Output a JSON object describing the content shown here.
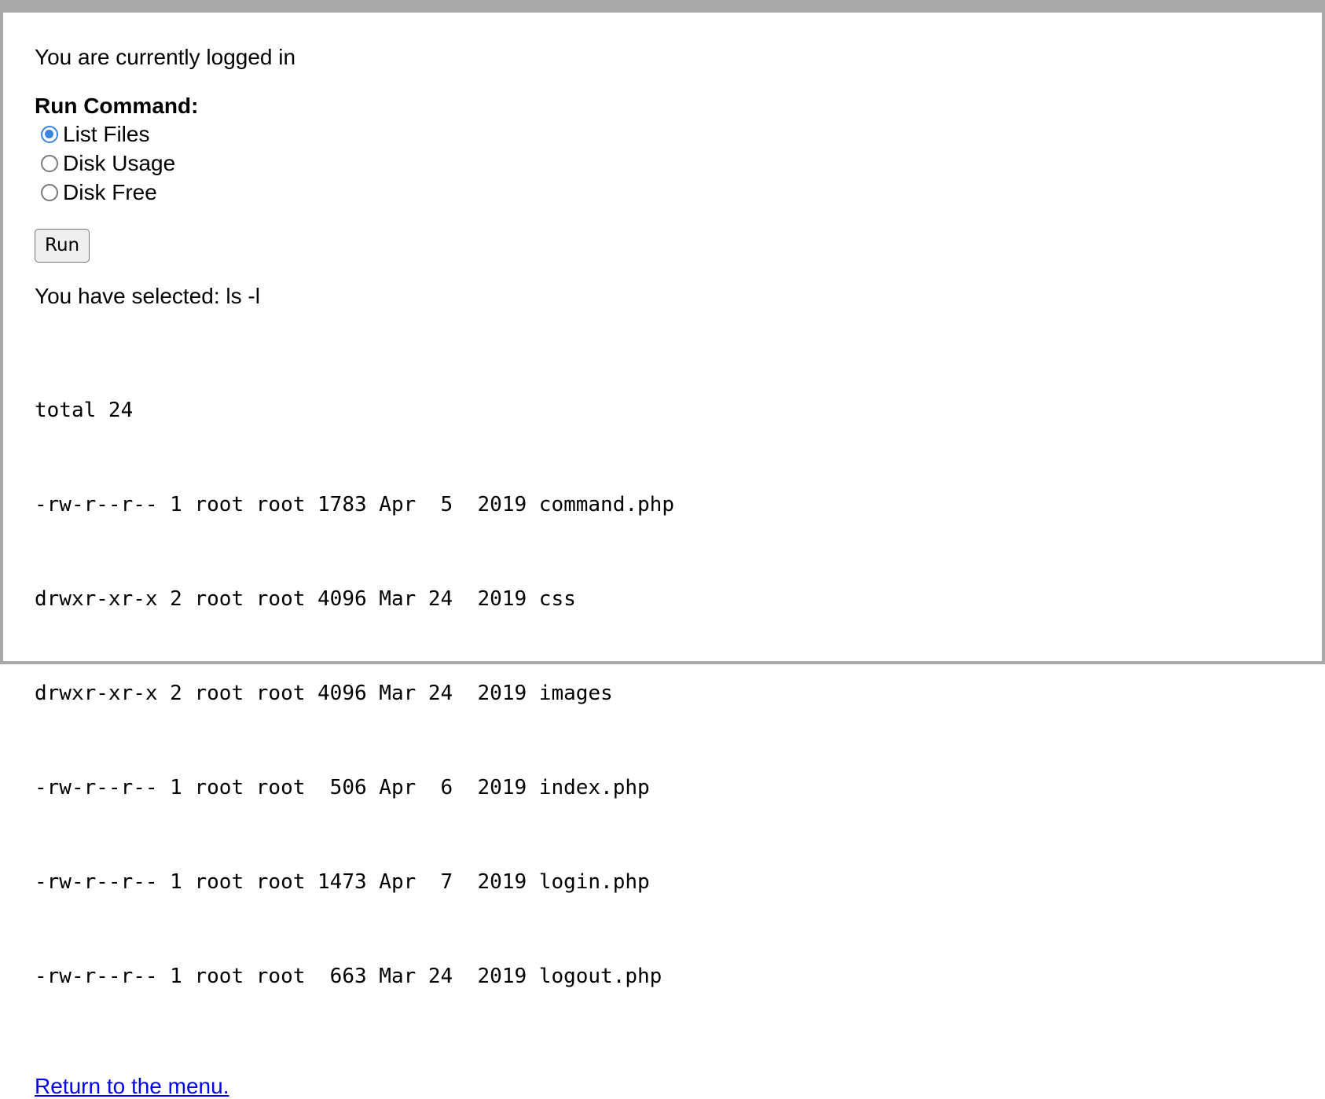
{
  "status_text": "You are currently logged in",
  "form": {
    "label": "Run Command:",
    "options": [
      {
        "label": "List Files",
        "checked": true
      },
      {
        "label": "Disk Usage",
        "checked": false
      },
      {
        "label": "Disk Free",
        "checked": false
      }
    ],
    "run_label": "Run"
  },
  "selected_text": "You have selected: ls -l",
  "output_lines": [
    "total 24",
    "-rw-r--r-- 1 root root 1783 Apr  5  2019 command.php",
    "drwxr-xr-x 2 root root 4096 Mar 24  2019 css",
    "drwxr-xr-x 2 root root 4096 Mar 24  2019 images",
    "-rw-r--r-- 1 root root  506 Apr  6  2019 index.php",
    "-rw-r--r-- 1 root root 1473 Apr  7  2019 login.php",
    "-rw-r--r-- 1 root root  663 Mar 24  2019 logout.php"
  ],
  "return_link": "Return to the menu.",
  "colors": {
    "accent": "#3a83e0",
    "link": "#0000ee",
    "frame": "#a9a9a9"
  }
}
